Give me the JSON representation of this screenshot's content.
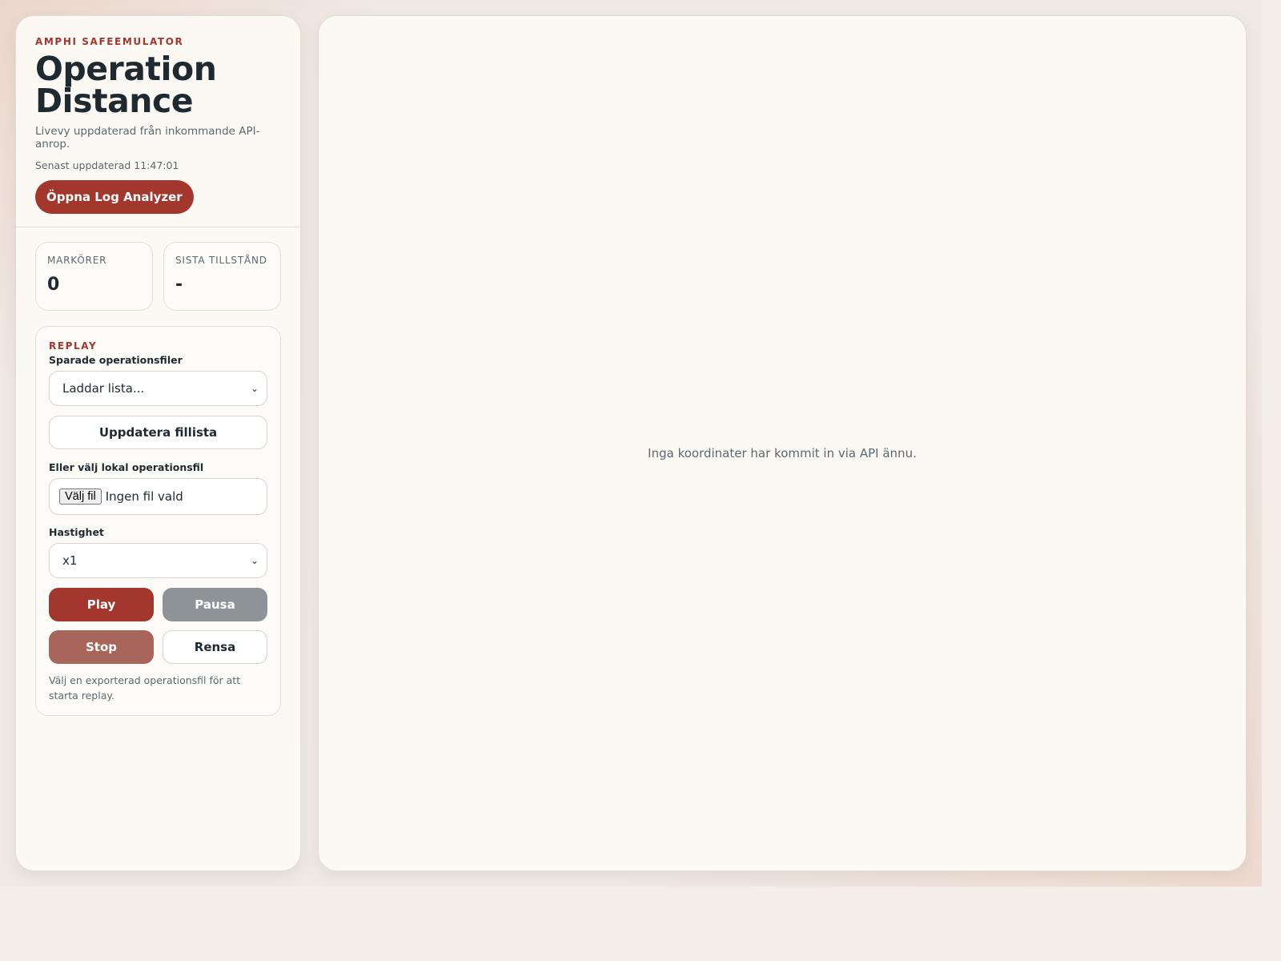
{
  "sidebar": {
    "eyebrow": "AMPHI SAFEEMULATOR",
    "title": "Operation Distance",
    "subtitle": "Livevy uppdaterad från inkommande API-anrop.",
    "updated": "Senast uppdaterad 11:47:01",
    "analyzer_button": "Öppna Log Analyzer",
    "stats": [
      {
        "label": "MARKÖRER",
        "value": "0"
      },
      {
        "label": "SISTA TILLSTÅND",
        "value": "-"
      }
    ],
    "replay": {
      "title": "REPLAY",
      "saved_files_label": "Sparade operationsfiler",
      "saved_files_value": "Laddar lista...",
      "refresh_button": "Uppdatera fillista",
      "local_file_label": "Eller välj lokal operationsfil",
      "file_button": "Välj fil",
      "file_status": "Ingen fil vald",
      "speed_label": "Hastighet",
      "speed_value": "x1",
      "play": "Play",
      "pause": "Pausa",
      "stop": "Stop",
      "clear": "Rensa",
      "hint": "Välj en exporterad operationsfil för att starta replay."
    }
  },
  "main": {
    "empty_message": "Inga koordinater har kommit in via API ännu."
  },
  "colors": {
    "accent": "#a3372d",
    "pause": "#8d9396",
    "stop": "#a9655c"
  },
  "icons": {
    "select_chevron": "chevron-down-icon"
  }
}
